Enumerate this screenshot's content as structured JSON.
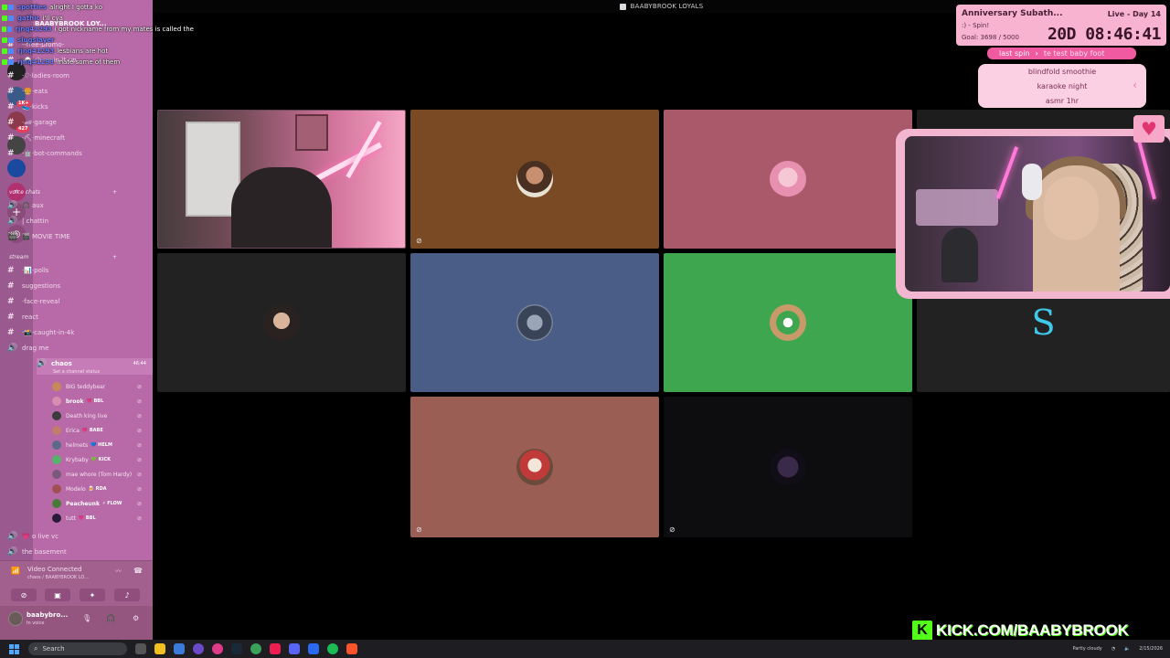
{
  "window": {
    "title": "BAABYBROOK LOYALS"
  },
  "server": {
    "name": "BAABYBROOK LOY..."
  },
  "chat": [
    {
      "user": "spotties",
      "message": "alright I gotta ko"
    },
    {
      "user": "gathic",
      "message": "i'll cya"
    },
    {
      "user": "rjnq41293",
      "message": "i got nickname from my mates is called the"
    },
    {
      "user": "slugslayer",
      "message": ""
    },
    {
      "user": "rjnq41293",
      "message": "lesbians are hot"
    },
    {
      "user": "rjnq41293",
      "message": "mate some of them"
    }
  ],
  "channels_top": [
    {
      "label": "·-free-promo-",
      "icon": "#"
    },
    {
      "label": "·🍙·choppin-it-up",
      "icon": "#"
    },
    {
      "label": "·♡·ladies-room",
      "icon": "#"
    },
    {
      "label": "·🍔·eats",
      "icon": "#"
    },
    {
      "label": "👟·kicks",
      "icon": "#"
    },
    {
      "label": "·🏎·garage",
      "icon": "#"
    },
    {
      "label": "·⛏·minecraft",
      "icon": "#"
    },
    {
      "label": "·🤖·bot-commands",
      "icon": "#"
    }
  ],
  "categories": {
    "voice": "voice chats",
    "stream": "stream"
  },
  "voice_channels_a": [
    {
      "label": "🎧 aux",
      "icon": "🔊"
    },
    {
      "label": "| chattin",
      "icon": "🔊"
    },
    {
      "label": "🎬 MOVIE TIME",
      "icon": "🎬"
    }
  ],
  "stream_channels": [
    {
      "label": "·📊·polls",
      "icon": "#"
    },
    {
      "label": "suggestions",
      "icon": "#"
    },
    {
      "label": "·face-reveal",
      "icon": "#"
    },
    {
      "label": "react",
      "icon": "#"
    },
    {
      "label": "·📸·caught-in-4k",
      "icon": "#"
    },
    {
      "label": "drag me",
      "icon": "🔊"
    }
  ],
  "active_voice": {
    "label": "chaos",
    "count": "46:44",
    "status": "Set a channel status"
  },
  "members": [
    {
      "name": "BIG teddybear",
      "tag": "",
      "bold": false,
      "color": "#c48a5a"
    },
    {
      "name": "brook",
      "tag": "💗 BBL",
      "bold": true,
      "color": "#d98db0"
    },
    {
      "name": "Death king live",
      "tag": "",
      "bold": false,
      "color": "#3c3c3c"
    },
    {
      "name": "Erica",
      "tag": "💗 BABE",
      "bold": false,
      "color": "#c27c6a"
    },
    {
      "name": "helmets",
      "tag": "💙 HELM",
      "bold": false,
      "color": "#5a6a8a"
    },
    {
      "name": "Krybaby",
      "tag": "💚 KICK",
      "bold": false,
      "color": "#53b46a"
    },
    {
      "name": "mae whore (Tom Hardy)",
      "tag": "",
      "bold": false,
      "color": "#7a5a7a"
    },
    {
      "name": "Modelo",
      "tag": "🍺 RDA",
      "bold": false,
      "color": "#a05050"
    },
    {
      "name": "Peacheunk",
      "tag": "⚡ FLOW",
      "bold": true,
      "color": "#4a7a3a"
    },
    {
      "name": "tutt",
      "tag": "💗 BBL",
      "bold": false,
      "color": "#2a1a3a"
    }
  ],
  "voice_channels_b": [
    {
      "label": "💗 o live vc",
      "icon": "🔊"
    },
    {
      "label": "the basement",
      "icon": "🔊"
    }
  ],
  "voice_status": {
    "title": "Video Connected",
    "sub": "chaos / BAABYBROOK LO..."
  },
  "user_panel": {
    "name": "baabybro...",
    "status": "In voice"
  },
  "anniversary": {
    "title": "Anniversary Subath...",
    "spin": ":) - Spin!",
    "goal": "Goal: 3698 / 5000",
    "live": "Live - Day 14",
    "timer": "20D 08:46:41"
  },
  "last_spin": {
    "label": "last spin",
    "value": "te test baby foot"
  },
  "wheel_items": [
    "blindfold smoothie",
    "karaoke night",
    "asmr 1hr"
  ],
  "kick_banner": "KICK.COM/BAABYBROOK",
  "taskbar": {
    "search_placeholder": "Search",
    "weather": "Partly cloudy",
    "date": "2/15/2026"
  },
  "colors": {
    "tile_brown": "#7a4a25",
    "tile_rose": "#a9596a",
    "tile_dark": "#222222",
    "tile_slate": "#4a5d87",
    "tile_green": "#3fa650",
    "tile_terracotta": "#9a5e55",
    "kick_green": "#53fc18"
  }
}
